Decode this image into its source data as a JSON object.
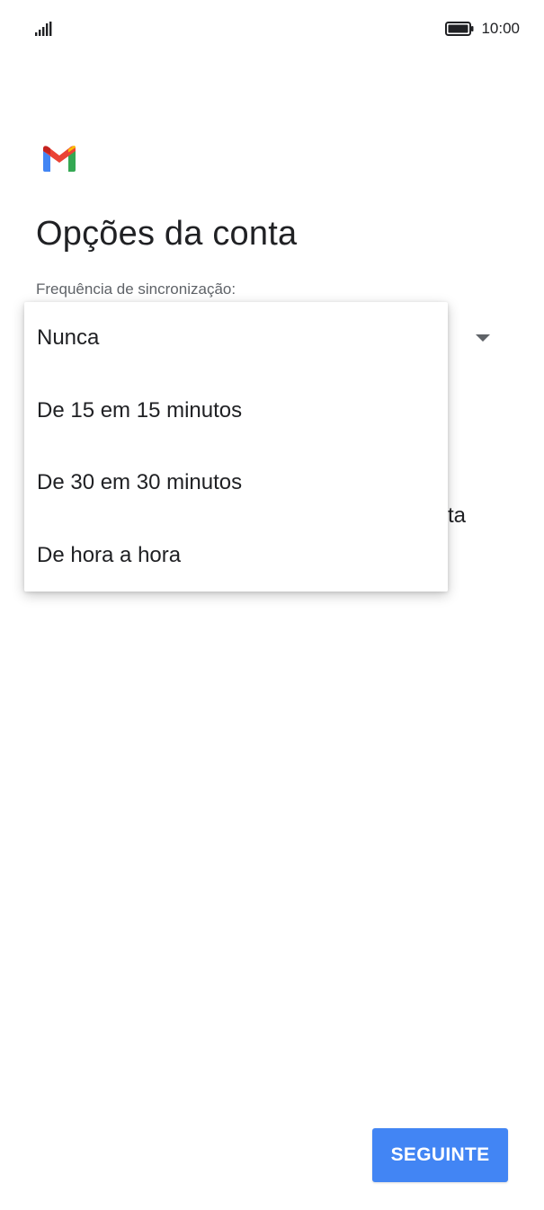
{
  "status_bar": {
    "signal_icon": "signal-bars-icon",
    "battery_icon": "battery-icon",
    "time": "10:00"
  },
  "logo": {
    "icon": "gmail-logo-icon",
    "colors": [
      "#4285f4",
      "#ea4335",
      "#fbbc04",
      "#34a853",
      "#c5221f"
    ]
  },
  "header": {
    "title": "Opções da conta"
  },
  "sync_field": {
    "label": "Frequência de sincronização:",
    "arrow_icon": "dropdown-arrow-icon",
    "obscured_text": "ta"
  },
  "sync_menu": {
    "options": [
      {
        "label": "Nunca"
      },
      {
        "label": "De 15 em 15 minutos"
      },
      {
        "label": "De 30 em 30 minutos"
      },
      {
        "label": "De hora a hora"
      }
    ]
  },
  "footer": {
    "next_label": "SEGUINTE",
    "next_color": "#4285f4"
  }
}
